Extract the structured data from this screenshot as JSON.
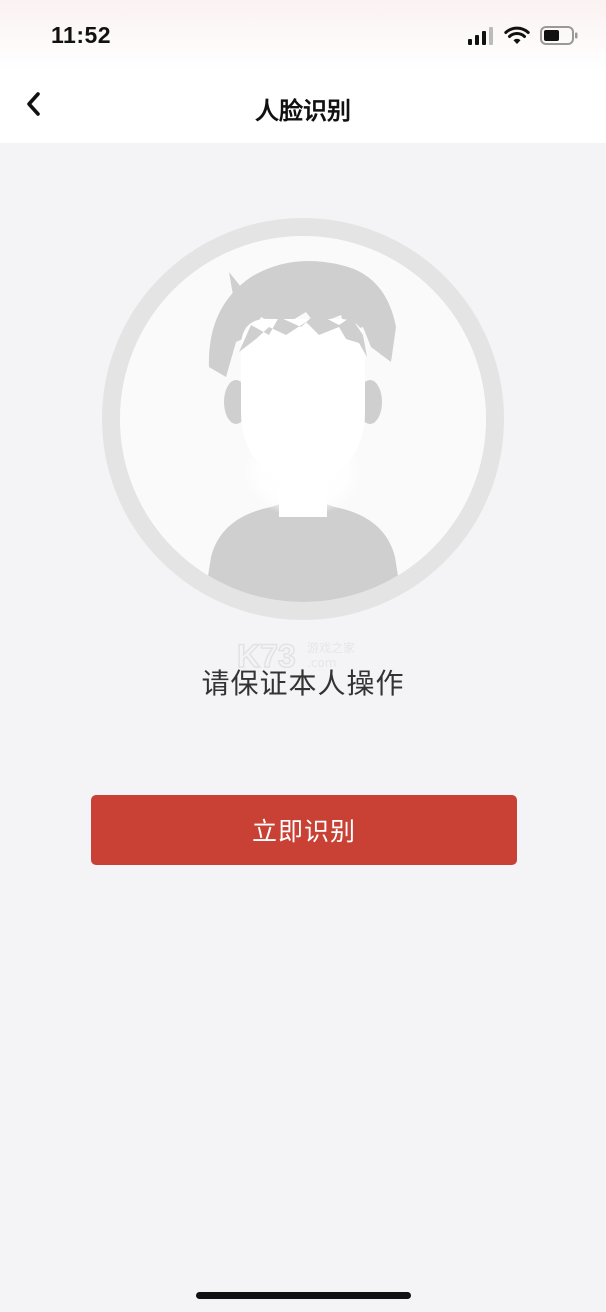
{
  "status_bar": {
    "time": "11:52",
    "icons": [
      "cellular-signal-icon",
      "wifi-icon",
      "battery-icon"
    ]
  },
  "nav": {
    "back_icon": "chevron-left-icon",
    "title": "人脸识别"
  },
  "main": {
    "avatar_icon": "face-placeholder-avatar",
    "prompt": "请保证本人操作",
    "watermark": {
      "logo": "K73",
      "subtitle": "游戏之家",
      "domain": ".com"
    },
    "primary_button_label": "立即识别"
  },
  "colors": {
    "primary_button": "#c94035",
    "background": "#f4f4f6",
    "ring": "#e4e4e4",
    "avatar_gray": "#cfcfcf"
  }
}
